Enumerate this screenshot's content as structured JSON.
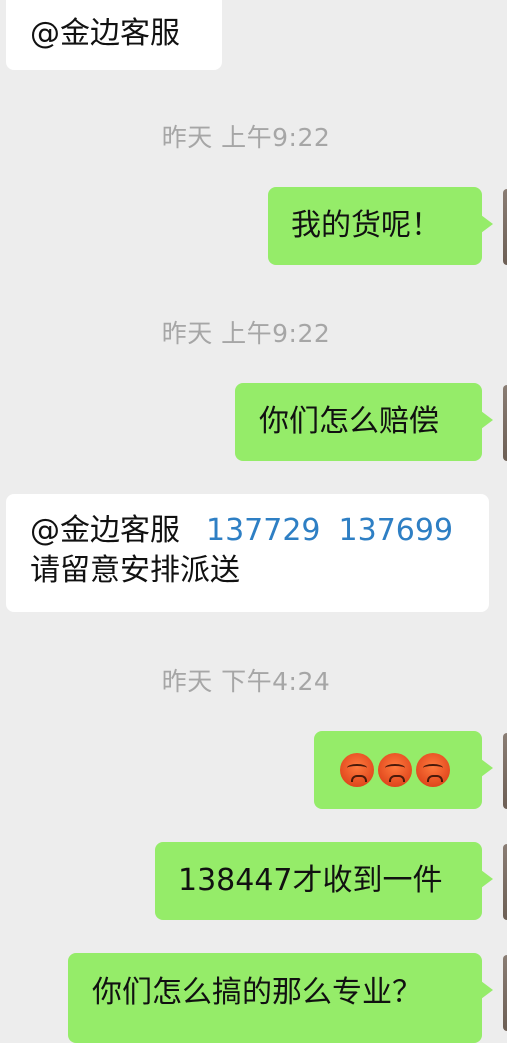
{
  "messages": [
    {
      "kind": "incoming",
      "mention": "@金边客服"
    },
    {
      "kind": "timestamp",
      "text": "昨天 上午9:22"
    },
    {
      "kind": "outgoing",
      "text": "我的货呢！"
    },
    {
      "kind": "timestamp",
      "text": "昨天 上午9:22"
    },
    {
      "kind": "outgoing",
      "text": "你们怎么赔偿"
    },
    {
      "kind": "incoming",
      "mention": "@金边客服",
      "link1": "137729",
      "link2": "137699",
      "line2": "请留意安排派送"
    },
    {
      "kind": "timestamp",
      "text": "昨天 下午4:24"
    },
    {
      "kind": "outgoing",
      "emoji": "angry-face-icon",
      "count": 3
    },
    {
      "kind": "outgoing",
      "text": "138447才收到一件"
    },
    {
      "kind": "outgoing",
      "text": "你们怎么搞的那么专业？"
    }
  ],
  "colors": {
    "background": "#ededed",
    "incoming_bubble": "#ffffff",
    "outgoing_bubble": "#95ec69",
    "link": "#2e7fc4",
    "timestamp": "#a6a6a6"
  }
}
